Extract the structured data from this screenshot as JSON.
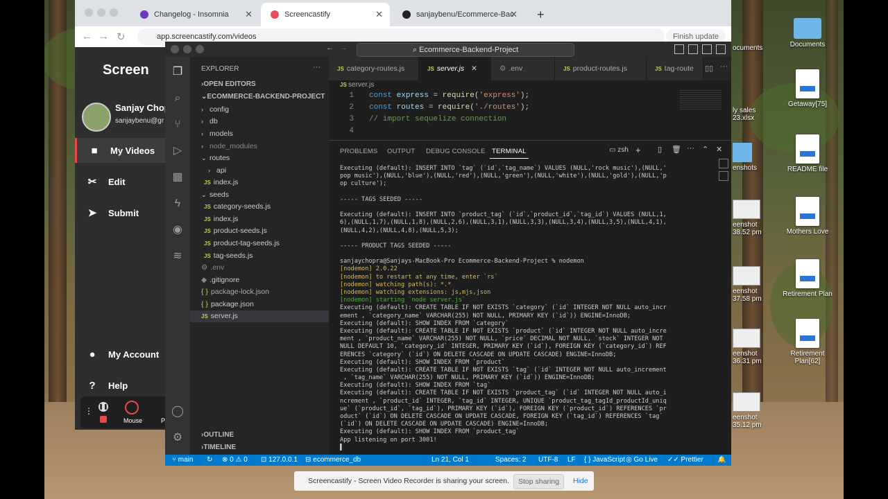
{
  "browser": {
    "tabs": [
      {
        "label": "Changelog - Insomnia",
        "favicon_color": "#6a3bbf"
      },
      {
        "label": "Screencastify",
        "favicon_color": "#e84a5f"
      },
      {
        "label": "sanjaybenu/Ecommerce-Bac",
        "favicon_color": "#222222"
      }
    ],
    "url": "app.screencastify.com/videos",
    "finish_update": "Finish update"
  },
  "screencastify": {
    "logo": "Screen",
    "user_name": "Sanjay Chop",
    "user_email": "sanjaybenu@gr",
    "nav": [
      "My Videos",
      "Edit",
      "Submit"
    ],
    "bottom_nav": [
      "My Account",
      "Help"
    ],
    "recorder_label": "Mouse",
    "recorder_partial": "Pe"
  },
  "vscode": {
    "search": "Ecommerce-Backend-Project",
    "explorer_title": "EXPLORER",
    "open_editors": "OPEN EDITORS",
    "project": "ECOMMERCE-BACKEND-PROJECT",
    "tree": [
      {
        "name": "config",
        "kind": "folder-closed"
      },
      {
        "name": "db",
        "kind": "folder-closed"
      },
      {
        "name": "models",
        "kind": "folder-closed"
      },
      {
        "name": "node_modules",
        "kind": "folder-dim"
      },
      {
        "name": "routes",
        "kind": "folder-open"
      },
      {
        "name": "api",
        "kind": "sub-folder"
      },
      {
        "name": "index.js",
        "kind": "sub-js"
      },
      {
        "name": "seeds",
        "kind": "folder-open"
      },
      {
        "name": "category-seeds.js",
        "kind": "sub-js"
      },
      {
        "name": "index.js",
        "kind": "sub-js"
      },
      {
        "name": "product-seeds.js",
        "kind": "sub-js"
      },
      {
        "name": "product-tag-seeds.js",
        "kind": "sub-js"
      },
      {
        "name": "tag-seeds.js",
        "kind": "sub-js"
      },
      {
        "name": ".env",
        "kind": "gear"
      },
      {
        "name": ".gitignore",
        "kind": "gear"
      },
      {
        "name": "package-lock.json",
        "kind": "json"
      },
      {
        "name": "package.json",
        "kind": "json"
      },
      {
        "name": "server.js",
        "kind": "js-selected"
      }
    ],
    "outline": "OUTLINE",
    "timeline": "TIMELINE",
    "editor_tabs": [
      "category-routes.js",
      "server.js",
      ".env",
      "product-routes.js",
      "tag-route"
    ],
    "breadcrumb": "server.js",
    "code_lines": [
      {
        "n": "1",
        "text": "const express = require('express');"
      },
      {
        "n": "2",
        "text": "const routes = require('./routes');"
      },
      {
        "n": "3",
        "text": "// import sequelize connection"
      },
      {
        "n": "4",
        "text": ""
      }
    ],
    "panel_tabs": [
      "PROBLEMS",
      "OUTPUT",
      "DEBUG CONSOLE",
      "TERMINAL"
    ],
    "shell": "zsh",
    "terminal_lines": [
      {
        "t": "Executing (default): INSERT INTO `tag` (`id`,`tag_name`) VALUES (NULL,'rock music'),(NULL,'",
        "c": ""
      },
      {
        "t": "pop music'),(NULL,'blue'),(NULL,'red'),(NULL,'green'),(NULL,'white'),(NULL,'gold'),(NULL,'p",
        "c": ""
      },
      {
        "t": "op culture');",
        "c": ""
      },
      {
        "t": "",
        "c": ""
      },
      {
        "t": "----- TAGS SEEDED -----",
        "c": ""
      },
      {
        "t": "",
        "c": ""
      },
      {
        "t": "Executing (default): INSERT INTO `product_tag` (`id`,`product_id`,`tag_id`) VALUES (NULL,1,",
        "c": ""
      },
      {
        "t": "6),(NULL,1,7),(NULL,1,8),(NULL,2,6),(NULL,3,1),(NULL,3,3),(NULL,3,4),(NULL,3,5),(NULL,4,1),",
        "c": ""
      },
      {
        "t": "(NULL,4,2),(NULL,4,8),(NULL,5,3);",
        "c": ""
      },
      {
        "t": "",
        "c": ""
      },
      {
        "t": "----- PRODUCT TAGS SEEDED -----",
        "c": ""
      },
      {
        "t": "",
        "c": ""
      },
      {
        "t": "sanjaychopra@Sanjays-MacBook-Pro Ecommerce-Backend-Project % nodemon",
        "c": ""
      },
      {
        "t": "[nodemon] 2.0.22",
        "c": "y"
      },
      {
        "t": "[nodemon] to restart at any time, enter `rs`",
        "c": "y"
      },
      {
        "t": "[nodemon] watching path(s): *.*",
        "c": "y"
      },
      {
        "t": "[nodemon] watching extensions: js,mjs,json",
        "c": "y"
      },
      {
        "t": "[nodemon] starting `node server.js`",
        "c": "g"
      },
      {
        "t": "Executing (default): CREATE TABLE IF NOT EXISTS `category` (`id` INTEGER NOT NULL auto_incr",
        "c": ""
      },
      {
        "t": "ement , `category_name` VARCHAR(255) NOT NULL, PRIMARY KEY (`id`)) ENGINE=InnoDB;",
        "c": ""
      },
      {
        "t": "Executing (default): SHOW INDEX FROM `category`",
        "c": ""
      },
      {
        "t": "Executing (default): CREATE TABLE IF NOT EXISTS `product` (`id` INTEGER NOT NULL auto_incre",
        "c": ""
      },
      {
        "t": "ment , `product_name` VARCHAR(255) NOT NULL, `price` DECIMAL NOT NULL, `stock` INTEGER NOT",
        "c": ""
      },
      {
        "t": "NULL DEFAULT 10, `category_id` INTEGER, PRIMARY KEY (`id`), FOREIGN KEY (`category_id`) REF",
        "c": ""
      },
      {
        "t": "ERENCES `category` (`id`) ON DELETE CASCADE ON UPDATE CASCADE) ENGINE=InnoDB;",
        "c": ""
      },
      {
        "t": "Executing (default): SHOW INDEX FROM `product`",
        "c": ""
      },
      {
        "t": "Executing (default): CREATE TABLE IF NOT EXISTS `tag` (`id` INTEGER NOT NULL auto_increment",
        "c": ""
      },
      {
        "t": " , `tag_name` VARCHAR(255) NOT NULL, PRIMARY KEY (`id`)) ENGINE=InnoDB;",
        "c": ""
      },
      {
        "t": "Executing (default): SHOW INDEX FROM `tag`",
        "c": ""
      },
      {
        "t": "Executing (default): CREATE TABLE IF NOT EXISTS `product_tag` (`id` INTEGER NOT NULL auto_i",
        "c": ""
      },
      {
        "t": "ncrement , `product_id` INTEGER, `tag_id` INTEGER, UNIQUE `product_tag_tagId_productId_uniq",
        "c": ""
      },
      {
        "t": "ue` (`product_id`, `tag_id`), PRIMARY KEY (`id`), FOREIGN KEY (`product_id`) REFERENCES `pr",
        "c": ""
      },
      {
        "t": "oduct` (`id`) ON DELETE CASCADE ON UPDATE CASCADE, FOREIGN KEY (`tag_id`) REFERENCES `tag`",
        "c": ""
      },
      {
        "t": "(`id`) ON DELETE CASCADE ON UPDATE CASCADE) ENGINE=InnoDB;",
        "c": ""
      },
      {
        "t": "Executing (default): SHOW INDEX FROM `product_tag`",
        "c": ""
      },
      {
        "t": "App listening on port 3001!",
        "c": ""
      },
      {
        "t": "▌",
        "c": ""
      }
    ],
    "status": {
      "branch": "main",
      "errors": "0",
      "warnings": "0",
      "remote": "127.0.0.1",
      "db": "ecommerce_db",
      "position": "Ln 21, Col 1",
      "spaces": "Spaces: 2",
      "encoding": "UTF-8",
      "eol": "LF",
      "language": "JavaScript",
      "golive": "Go Live",
      "prettier": "Prettier"
    }
  },
  "desktop": {
    "icons": [
      {
        "label": "Documents",
        "kind": "folder"
      },
      {
        "label": "Getaway[75]",
        "kind": "doc"
      },
      {
        "label": "README file",
        "kind": "doc"
      },
      {
        "label": "Mothers Love",
        "kind": "doc"
      },
      {
        "label": "Retirement Plan",
        "kind": "doc"
      },
      {
        "label": "Retirement Plan[62]",
        "kind": "doc"
      }
    ],
    "partial": {
      "documents": "ocuments",
      "sales1": "ly sales",
      "sales2": "23.xlsx",
      "shot1": "enshots",
      "shot2a": "eenshot",
      "shot2b": "38.52 pm",
      "shot3a": "eenshot",
      "shot3b": "37.58 pm",
      "shot4a": "eenshot",
      "shot4b": "36.31 pm",
      "shot5a": "eenshot",
      "shot5b": "35.12 pm"
    }
  },
  "sharebar": {
    "message": "Screencastify - Screen Video Recorder is sharing your screen.",
    "stop": "Stop sharing",
    "hide": "Hide"
  }
}
